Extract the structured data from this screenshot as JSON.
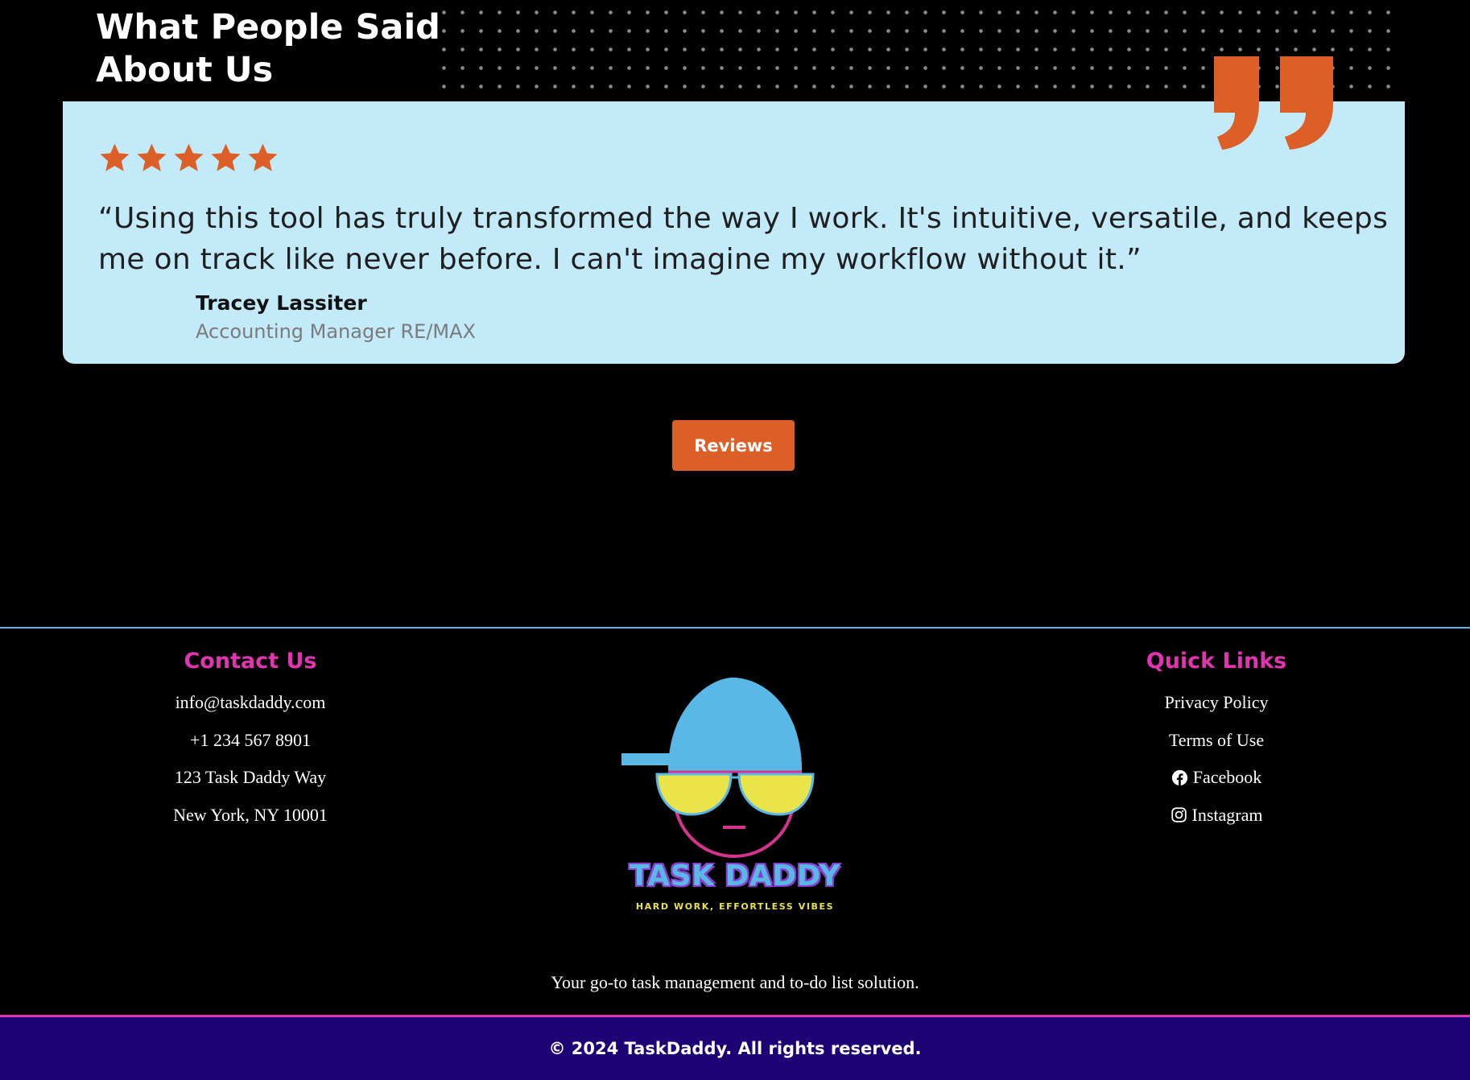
{
  "testimonials": {
    "heading": "What People Said\nAbout Us",
    "rating": 5,
    "quote": "“Using this tool has truly transformed the way I work. It's intuitive, versatile, and keeps me on track like never before. I can't imagine my workflow without it.”",
    "author_name": "Tracey Lassiter",
    "author_role": "Accounting Manager RE/MAX",
    "reviews_button": "Reviews"
  },
  "footer": {
    "contact": {
      "title": "Contact Us",
      "email": "info@taskdaddy.com",
      "phone": "+1 234 567 8901",
      "address_line1": "123 Task Daddy Way",
      "address_line2": "New York, NY 10001"
    },
    "logo": {
      "title": "TASK DADDY",
      "tagline": "HARD WORK, EFFORTLESS VIBES"
    },
    "quick_links": {
      "title": "Quick Links",
      "privacy": "Privacy Policy",
      "terms": "Terms of Use",
      "facebook": "Facebook",
      "instagram": "Instagram"
    },
    "description": "Your go-to task management and to-do list solution.",
    "copyright": "© 2024 TaskDaddy. All rights reserved."
  },
  "colors": {
    "accent_orange": "#dc5f27",
    "card_bg": "#c2eaf8",
    "footer_title_pink": "#e234b0",
    "cap_blue": "#5ab8e6",
    "glasses_yellow": "#eae34a",
    "copyright_bg": "#1d0276"
  },
  "icons": [
    "star-icon",
    "quote-mark-icon",
    "facebook-icon",
    "instagram-icon"
  ]
}
